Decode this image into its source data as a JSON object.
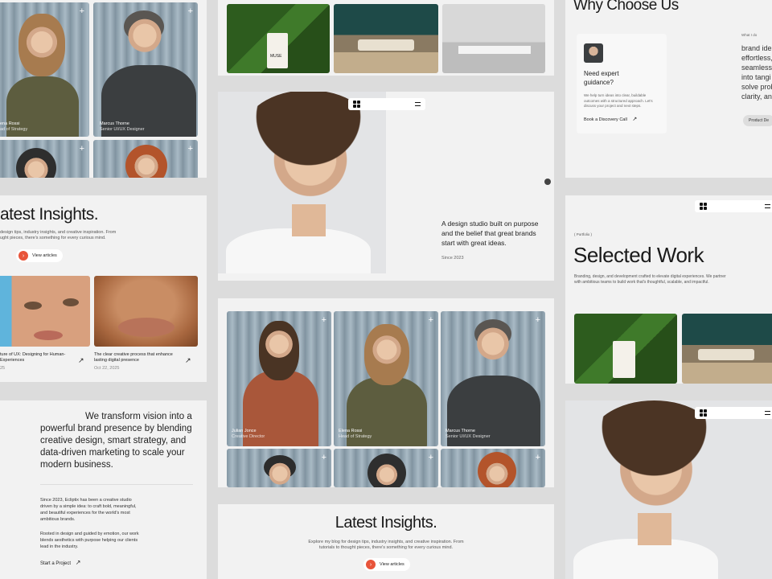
{
  "team": {
    "members": [
      {
        "name": "Julian Jonce",
        "role": "Creative Director"
      },
      {
        "name": "Elena Rossi",
        "role": "Head of Strategy"
      },
      {
        "name": "Marcus Thorne",
        "role": "Senior UI/UX Designer"
      }
    ],
    "left_partial": {
      "name": "ena Rossi",
      "role": "ad of Strategy"
    },
    "plus": "+"
  },
  "insights_left": {
    "title": "atest Insights.",
    "desc1": "design tips, industry insights, and creative inspiration. From",
    "desc2": "ught pieces, there's something for every curious mind.",
    "button": "View articles",
    "articles": [
      {
        "title": "ture of UX: Designing for Human-",
        "title2": "Experiences",
        "date": "25"
      },
      {
        "title": "The clear creative process that enhance",
        "title2": "lasting digital presence",
        "date": "Oct 22, 2025"
      }
    ]
  },
  "transform": {
    "headline": "We transform vision into a powerful brand presence by blending creative design, smart strategy, and data-driven marketing to scale your modern business.",
    "para1": "Since 2023, Ecliptix has been a creative studio driven by a simple idea: to craft bold, meaningful, and beautiful experiences for the world's most ambitious brands.",
    "para2": "Rooted in design and guided by emotion, our work blends aesthetics with purpose helping our clients lead in the industry.",
    "cta": "Start a Project"
  },
  "hero": {
    "tagline": "A design studio built on purpose and the belief that great brands start with great ideas.",
    "since": "Since 2023",
    "bag_text": "MUSE"
  },
  "insights_bottom": {
    "title": "Latest Insights.",
    "desc1": "Explore my blog for design tips, industry insights, and creative inspiration. From",
    "desc2": "tutorials to thought pieces, there's something for every curious mind.",
    "button": "View articles"
  },
  "why": {
    "title": "Why Choose Us",
    "card_title": "Need expert guidance?",
    "card_desc": "We help turn ideas into clear, buildable outcomes with a structured approach. Let's discuss your project and next steps.",
    "card_cta": "Book a Discovery Call",
    "what_label": "What I do",
    "side_text": [
      "brand ide",
      "effortless,",
      "seamless",
      "into tangi",
      "solve prob",
      "clarity, an"
    ],
    "side_button": "Product De"
  },
  "selected": {
    "label": "( Portfolio )",
    "title": "Selected Work",
    "desc1": "Branding, design, and development crafted to elevate digital experiences. We partner",
    "desc2": "with ambitious teams to build work that's thoughtful, scalable, and impactful."
  },
  "icons": {
    "arrow": "↗",
    "menu": "menu-icon",
    "logo": "logo-icon"
  },
  "colors": {
    "accent": "#e8543a",
    "card": "#f2f2f2",
    "bg": "#dcdcdc"
  }
}
